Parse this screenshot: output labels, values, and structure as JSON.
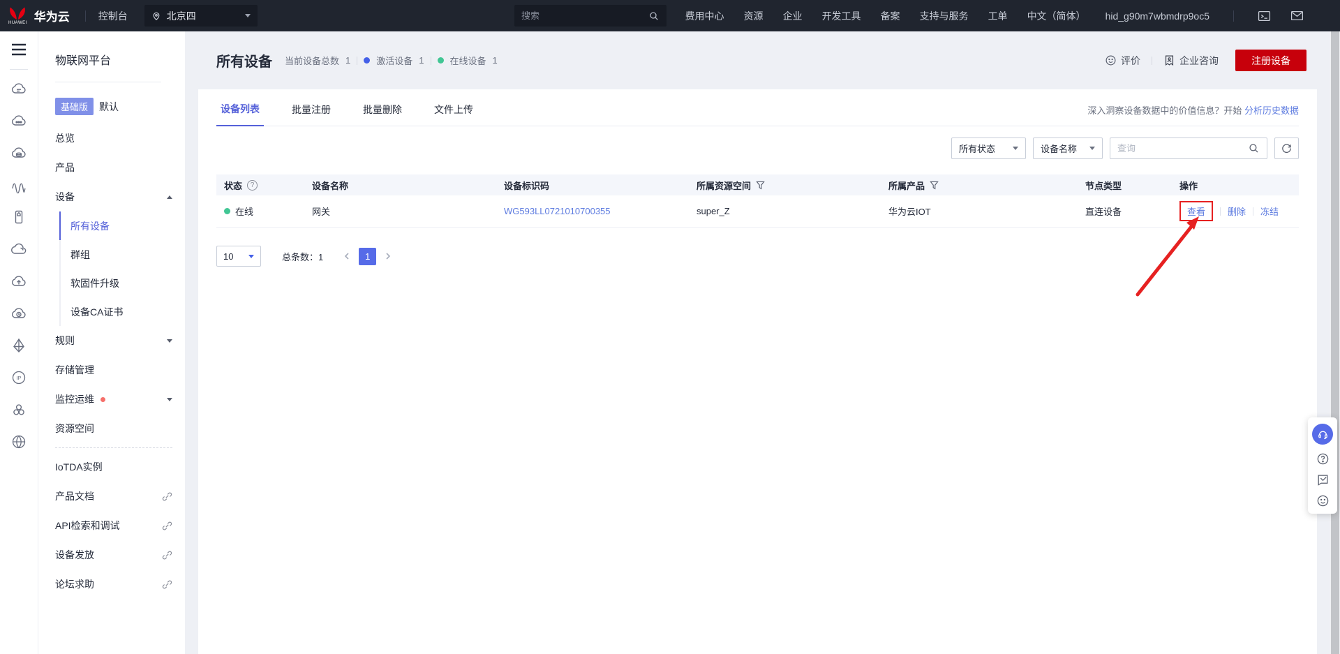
{
  "topbar": {
    "brand": "华为云",
    "console": "控制台",
    "region": "北京四",
    "search_placeholder": "搜索",
    "menu": [
      "费用中心",
      "资源",
      "企业",
      "开发工具",
      "备案",
      "支持与服务",
      "工单"
    ],
    "language": "中文（简体）",
    "account": "hid_g90m7wbmdrp9oc5"
  },
  "sidebar": {
    "title": "物联网平台",
    "edition_badge": "基础版",
    "edition_name": "默认",
    "items": {
      "overview": "总览",
      "product": "产品",
      "device": "设备",
      "all_devices": "所有设备",
      "groups": "群组",
      "firmware": "软固件升级",
      "ca": "设备CA证书",
      "rules": "规则",
      "storage": "存储管理",
      "monitor": "监控运维",
      "space": "资源空间",
      "iotda": "IoTDA实例",
      "docs": "产品文档",
      "api": "API检索和调试",
      "provision": "设备发放",
      "forum": "论坛求助"
    }
  },
  "header": {
    "title": "所有设备",
    "stats": [
      {
        "label": "当前设备总数",
        "value": "1"
      },
      {
        "label": "激活设备",
        "value": "1"
      },
      {
        "label": "在线设备",
        "value": "1"
      }
    ],
    "rate": "评价",
    "consult": "企业咨询",
    "register": "注册设备"
  },
  "tabs": {
    "device_list": "设备列表",
    "batch_register": "批量注册",
    "batch_delete": "批量删除",
    "file_upload": "文件上传",
    "promo_text": "深入洞察设备数据中的价值信息？开始",
    "promo_link": "分析历史数据"
  },
  "filters": {
    "status": "所有状态",
    "field": "设备名称",
    "query_placeholder": "查询"
  },
  "table": {
    "columns": [
      "状态",
      "设备名称",
      "设备标识码",
      "所属资源空间",
      "所属产品",
      "节点类型",
      "操作"
    ],
    "row": {
      "status": "在线",
      "name": "网关",
      "code": "WG593LL0721010700355",
      "space": "super_Z",
      "product": "华为云IOT",
      "node_type": "直连设备",
      "view": "查看",
      "delete": "删除",
      "freeze": "冻结"
    }
  },
  "pagination": {
    "page_size": "10",
    "total": "总条数：1",
    "page": "1"
  },
  "colors": {
    "accent": "#5561d9",
    "link": "#5e7ce0",
    "brand_red": "#c7000b",
    "annotation_red": "#e62121",
    "online_green": "#41c694",
    "activated_blue": "#4460e8"
  }
}
